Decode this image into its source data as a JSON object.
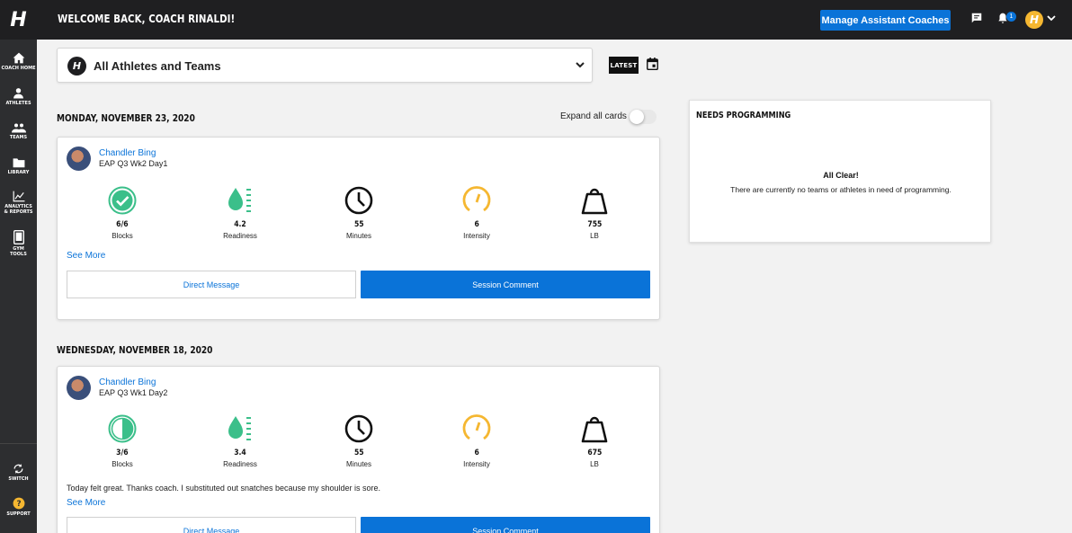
{
  "header": {
    "welcome": "WELCOME BACK, COACH RINALDI!",
    "manage_button": "Manage Assistant Coaches",
    "notification_count": "1"
  },
  "sidebar": {
    "items": [
      {
        "label": "COACH HOME",
        "icon": "home-icon"
      },
      {
        "label": "ATHLETES",
        "icon": "person-icon"
      },
      {
        "label": "TEAMS",
        "icon": "group-icon"
      },
      {
        "label": "LIBRARY",
        "icon": "folder-icon"
      },
      {
        "label": "ANALYTICS & REPORTS",
        "icon": "chart-icon"
      },
      {
        "label": "GYM TOOLS",
        "icon": "tablet-icon"
      }
    ],
    "bottom_items": [
      {
        "label": "SWITCH",
        "icon": "switch-icon"
      },
      {
        "label": "SUPPORT",
        "icon": "help-icon"
      }
    ]
  },
  "selector": {
    "value": "All Athletes and Teams"
  },
  "latest_button": "LATEST",
  "expand_all_label": "Expand all cards",
  "feed": [
    {
      "date": "MONDAY, NOVEMBER 23, 2020",
      "athlete": "Chandler  Bing",
      "session": "EAP Q3 Wk2 Day1",
      "metrics": [
        {
          "value": "6/6",
          "label": "Blocks"
        },
        {
          "value": "4.2",
          "label": "Readiness"
        },
        {
          "value": "55",
          "label": "Minutes"
        },
        {
          "value": "6",
          "label": "Intensity"
        },
        {
          "value": "755",
          "label": "LB"
        }
      ],
      "comment": "",
      "see_more": "See More",
      "direct_message": "Direct Message",
      "session_comment": "Session Comment"
    },
    {
      "date": "WEDNESDAY, NOVEMBER 18, 2020",
      "athlete": "Chandler  Bing",
      "session": "EAP Q3 Wk1 Day2",
      "metrics": [
        {
          "value": "3/6",
          "label": "Blocks"
        },
        {
          "value": "3.4",
          "label": "Readiness"
        },
        {
          "value": "55",
          "label": "Minutes"
        },
        {
          "value": "6",
          "label": "Intensity"
        },
        {
          "value": "675",
          "label": "LB"
        }
      ],
      "comment": "Today felt great. Thanks coach. I substituted out snatches because my shoulder is sore.",
      "see_more": "See More",
      "direct_message": "Direct Message",
      "session_comment": "Session Comment"
    }
  ],
  "needs_programming": {
    "title": "NEEDS PROGRAMMING",
    "status": "All Clear!",
    "message": "There are currently no teams or athletes in need of programming."
  },
  "colors": {
    "accent": "#0a73d8",
    "success": "#3bbf8a",
    "intensity": "#f5b731",
    "topbar": "#1f1f21",
    "sidebar": "#2d2e30"
  }
}
